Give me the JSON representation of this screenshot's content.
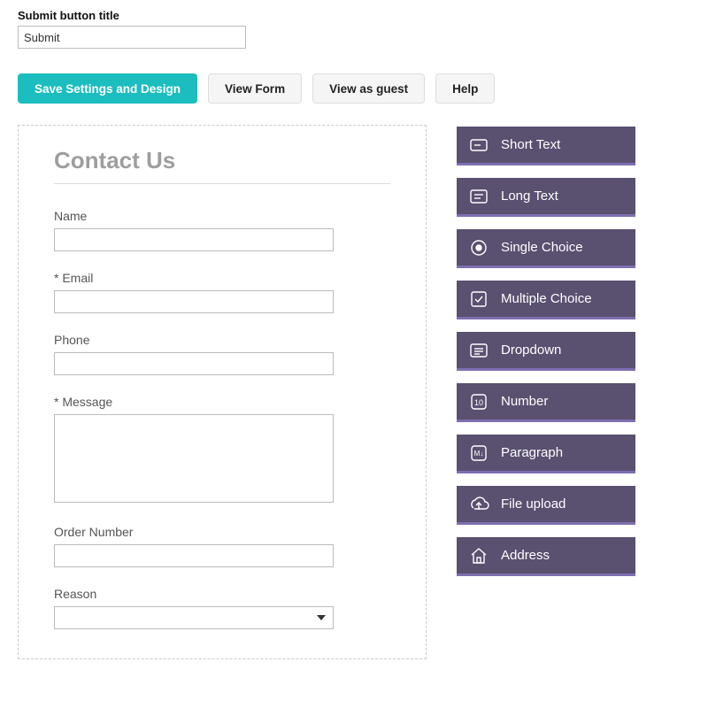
{
  "top": {
    "label": "Submit button title",
    "value": "Submit"
  },
  "toolbar": {
    "save": "Save Settings and Design",
    "view_form": "View Form",
    "view_guest": "View as guest",
    "help": "Help"
  },
  "form": {
    "title": "Contact Us",
    "fields": {
      "name": "Name",
      "email": "* Email",
      "phone": "Phone",
      "message": "* Message",
      "order_number": "Order Number",
      "reason": "Reason"
    }
  },
  "sidebar": {
    "items": [
      {
        "id": "short-text",
        "label": "Short Text",
        "icon": "short-text-icon"
      },
      {
        "id": "long-text",
        "label": "Long Text",
        "icon": "long-text-icon"
      },
      {
        "id": "single-choice",
        "label": "Single Choice",
        "icon": "single-choice-icon"
      },
      {
        "id": "multiple-choice",
        "label": "Multiple Choice",
        "icon": "multiple-choice-icon"
      },
      {
        "id": "dropdown",
        "label": "Dropdown",
        "icon": "dropdown-icon"
      },
      {
        "id": "number",
        "label": "Number",
        "icon": "number-icon"
      },
      {
        "id": "paragraph",
        "label": "Paragraph",
        "icon": "paragraph-icon"
      },
      {
        "id": "file-upload",
        "label": "File upload",
        "icon": "file-upload-icon"
      },
      {
        "id": "address",
        "label": "Address",
        "icon": "address-icon"
      }
    ]
  }
}
